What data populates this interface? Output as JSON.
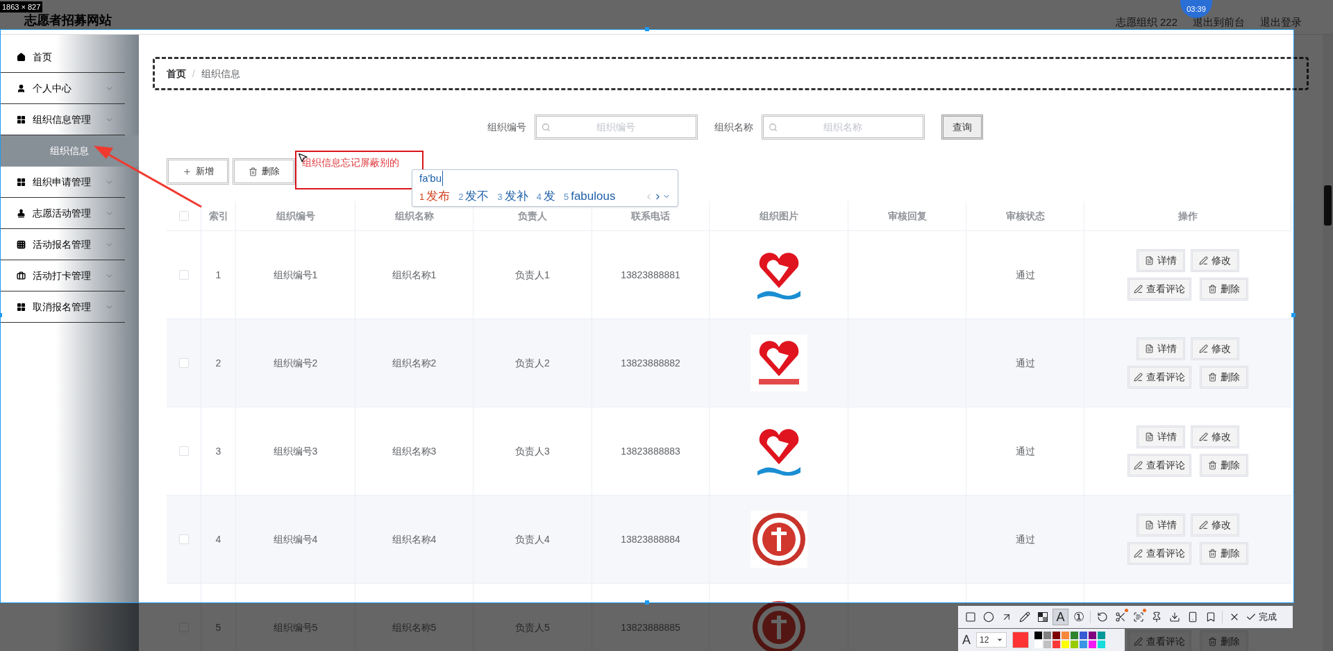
{
  "capture": {
    "size_label": "1863 × 827",
    "clock": "03:39"
  },
  "header": {
    "title": "志愿者招募网站",
    "user": "志愿组织 222",
    "links": [
      "退出到前台",
      "退出登录"
    ]
  },
  "sidebar": {
    "items": [
      {
        "kind": "link",
        "label": "首页"
      },
      {
        "kind": "menu",
        "label": "个人中心"
      },
      {
        "kind": "menu",
        "label": "组织信息管理",
        "children": [
          {
            "label": "组织信息",
            "selected": true
          }
        ]
      },
      {
        "kind": "menu",
        "label": "组织申请管理"
      },
      {
        "kind": "menu",
        "label": "志愿活动管理"
      },
      {
        "kind": "menu",
        "label": "活动报名管理"
      },
      {
        "kind": "menu",
        "label": "活动打卡管理"
      },
      {
        "kind": "menu",
        "label": "取消报名管理"
      }
    ]
  },
  "breadcrumb": [
    "首页",
    "组织信息"
  ],
  "breadcrumb_separator": "/",
  "search": {
    "fields": [
      {
        "label": "组织编号",
        "placeholder": "组织编号"
      },
      {
        "label": "组织名称",
        "placeholder": "组织名称"
      }
    ],
    "button": "查询"
  },
  "toolbar": [
    {
      "kind": "add",
      "label": "新增"
    },
    {
      "kind": "delete",
      "label": "删除"
    }
  ],
  "table": {
    "select_all_checked": false,
    "columns": [
      "索引",
      "组织编号",
      "组织名称",
      "负责人",
      "联系电话",
      "组织图片",
      "审核回复",
      "审核状态",
      "操作"
    ],
    "rows": [
      {
        "checked": false,
        "index": "1",
        "code": "组织编号1",
        "name": "组织名称1",
        "leader": "负责人1",
        "phone": "13823888881",
        "picture": {
          "kind": "picture"
        },
        "status": "通过",
        "actions": [
          {
            "kind": "detail",
            "label": "详情"
          },
          {
            "kind": "edit",
            "label": "修改"
          },
          {
            "kind": "comments",
            "label": "查看评论"
          },
          {
            "kind": "delete",
            "label": "删除"
          }
        ]
      },
      {
        "checked": false,
        "index": "2",
        "code": "组织编号2",
        "name": "组织名称2",
        "leader": "负责人2",
        "phone": "13823888882",
        "picture": {
          "kind": "picture"
        },
        "status": "通过",
        "actions": [
          {
            "kind": "detail",
            "label": "详情"
          },
          {
            "kind": "edit",
            "label": "修改"
          },
          {
            "kind": "comments",
            "label": "查看评论"
          },
          {
            "kind": "delete",
            "label": "删除"
          }
        ]
      },
      {
        "checked": false,
        "index": "3",
        "code": "组织编号3",
        "name": "组织名称3",
        "leader": "负责人3",
        "phone": "13823888883",
        "picture": {
          "kind": "picture"
        },
        "status": "通过",
        "actions": [
          {
            "kind": "detail",
            "label": "详情"
          },
          {
            "kind": "edit",
            "label": "修改"
          },
          {
            "kind": "comments",
            "label": "查看评论"
          },
          {
            "kind": "delete",
            "label": "删除"
          }
        ]
      },
      {
        "checked": false,
        "index": "4",
        "code": "组织编号4",
        "name": "组织名称4",
        "leader": "负责人4",
        "phone": "13823888884",
        "picture": {
          "kind": "picture"
        },
        "status": "通过",
        "actions": [
          {
            "kind": "detail",
            "label": "详情"
          },
          {
            "kind": "edit",
            "label": "修改"
          },
          {
            "kind": "comments",
            "label": "查看评论"
          },
          {
            "kind": "delete",
            "label": "删除"
          }
        ]
      },
      {
        "checked": false,
        "index": "5",
        "code": "组织编号5",
        "name": "组织名称5",
        "leader": "负责人5",
        "phone": "13823888885",
        "picture": {
          "kind": "picture"
        },
        "actions": [
          {
            "kind": "comments",
            "label": "查看评论"
          },
          {
            "kind": "delete",
            "label": "删除"
          }
        ]
      }
    ]
  },
  "annotation": {
    "text": "组织信息忘记屏蔽别的"
  },
  "ime": {
    "input": "fa'bu",
    "candidates": [
      {
        "number": "1",
        "text": "发布",
        "selected": true
      },
      {
        "number": "2",
        "text": "发不",
        "selected": false
      },
      {
        "number": "3",
        "text": "发补",
        "selected": false
      },
      {
        "number": "4",
        "text": "发",
        "selected": false
      },
      {
        "number": "5",
        "text": "fabulous",
        "selected": false
      }
    ]
  },
  "capture_toolbar": {
    "tools": [
      {
        "kind": "rect",
        "selected": false
      },
      {
        "kind": "ellipse",
        "selected": false
      },
      {
        "kind": "arrow",
        "selected": false
      },
      {
        "kind": "pencil",
        "selected": false
      },
      {
        "kind": "mosaic",
        "selected": false
      },
      {
        "kind": "text",
        "label": "A",
        "selected": true
      },
      {
        "kind": "number",
        "label": "①",
        "selected": false
      },
      {
        "kind": "undo",
        "selected": false
      },
      {
        "kind": "scissors",
        "selected": false,
        "dot": true
      },
      {
        "kind": "scan",
        "selected": false,
        "dot": true
      },
      {
        "kind": "pin",
        "selected": false
      },
      {
        "kind": "download",
        "selected": false
      },
      {
        "kind": "phone",
        "selected": false
      },
      {
        "kind": "bookmark",
        "selected": false
      },
      {
        "kind": "close",
        "selected": false
      }
    ],
    "done": "完成",
    "font_label": "A",
    "font_size": "12",
    "current_color": {
      "color": "#ff3333"
    },
    "palette": [
      {
        "color": "#000000"
      },
      {
        "color": "#808080"
      },
      {
        "color": "#800000"
      },
      {
        "color": "#f7883a"
      },
      {
        "color": "#308430"
      },
      {
        "color": "#385ad3"
      },
      {
        "color": "#800080"
      },
      {
        "color": "#009999"
      },
      {
        "color": "#ffffff"
      },
      {
        "color": "#c0c0c0"
      },
      {
        "color": "#fb3838"
      },
      {
        "color": "#ffff00"
      },
      {
        "color": "#99cc00"
      },
      {
        "color": "#3894e4"
      },
      {
        "color": "#f31bf3"
      },
      {
        "color": "#16dcdc"
      }
    ]
  }
}
